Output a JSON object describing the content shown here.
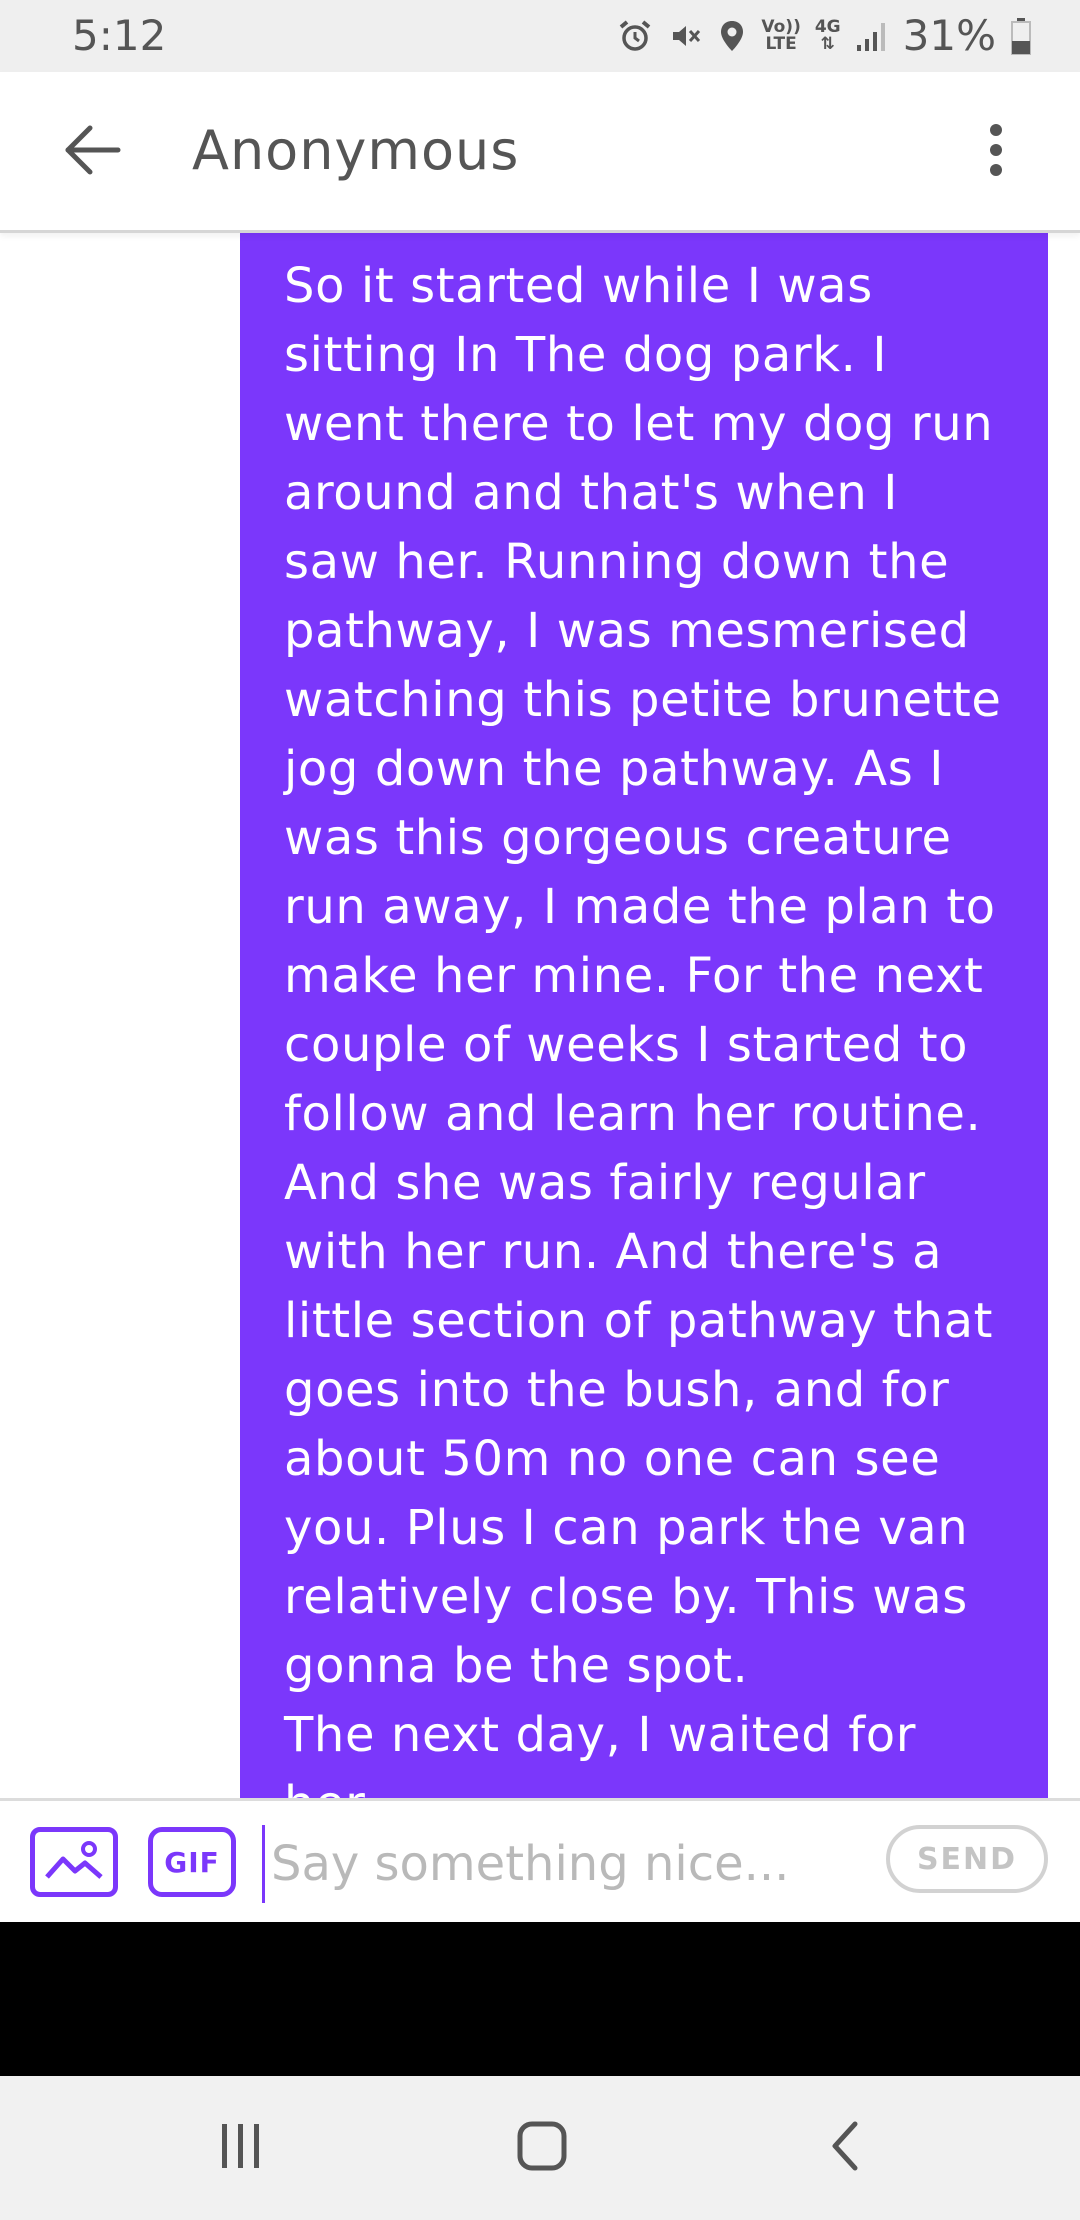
{
  "status_bar": {
    "time": "5:12",
    "network_top": "Vo))",
    "network_bottom": "LTE",
    "data_type": "4G",
    "battery_percent": "31%",
    "icons": [
      "alarm-icon",
      "mute-icon",
      "location-icon",
      "volte-icon",
      "4g-data-icon",
      "signal-icon",
      "battery-icon"
    ]
  },
  "header": {
    "title": "Anonymous",
    "back_icon": "back-arrow-icon",
    "menu_icon": "more-vert-icon"
  },
  "message": {
    "text": "So it started while I was\nsitting In The dog park. I\nwent there to let my dog run\naround and that's when I\nsaw her. Running down the\npathway, I was mesmerised\nwatching this petite brunette\njog down the pathway. As I\nwas this gorgeous creature\nrun away, I made the plan to\nmake her mine. For the next\ncouple of weeks I started to\nfollow and learn her routine.\nAnd she was fairly regular\nwith her run. And there's a\nlittle section of pathway that\ngoes into the bush, and for\nabout 50m no one can see\nyou. Plus I can park the van\nrelatively close by. This was\ngonna be the spot.\nThe next day, I waited for her\nto come by. And can hear",
    "bubble_color": "#7b37fb"
  },
  "compose": {
    "image_icon": "image-icon",
    "gif_label": "GIF",
    "placeholder": "Say something nice...",
    "value": "",
    "send_label": "SEND"
  },
  "nav": {
    "icons": [
      "recents-icon",
      "home-icon",
      "back-icon"
    ]
  },
  "colors": {
    "accent": "#7b37fb",
    "text_gray": "#555555",
    "status_bar_bg": "#efefef",
    "nav_bar_bg": "#f1f1f1"
  }
}
